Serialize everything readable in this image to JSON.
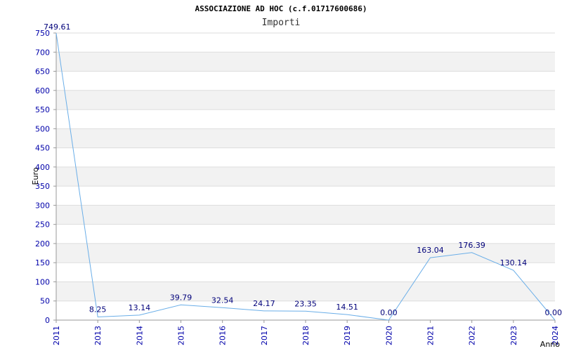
{
  "chart_data": {
    "type": "line",
    "title": "ASSOCIAZIONE AD HOC (c.f.01717600686)",
    "subtitle": "Importi",
    "xlabel": "Anno",
    "ylabel": "Euro",
    "ylim": [
      0,
      750
    ],
    "yticks": [
      0,
      50,
      100,
      150,
      200,
      250,
      300,
      350,
      400,
      450,
      500,
      550,
      600,
      650,
      700,
      750
    ],
    "grid": "horizontal bands",
    "categories": [
      "2011",
      "2013",
      "2014",
      "2015",
      "2016",
      "2017",
      "2018",
      "2019",
      "2020",
      "2021",
      "2022",
      "2023",
      "2024"
    ],
    "values": [
      749.61,
      8.25,
      13.14,
      39.79,
      32.54,
      24.17,
      23.35,
      14.51,
      0.0,
      163.04,
      176.39,
      130.14,
      0.0
    ],
    "labels": [
      "749.61",
      "8.25",
      "13.14",
      "39.79",
      "32.54",
      "24.17",
      "23.35",
      "14.51",
      "0.00",
      "163.04",
      "176.39",
      "130.14",
      "0.00"
    ],
    "colors": {
      "line": "#6aaee8",
      "label": "#00007a",
      "ticks": "#0000aa",
      "band": "#f2f2f2",
      "grid": "#dddddd"
    }
  }
}
